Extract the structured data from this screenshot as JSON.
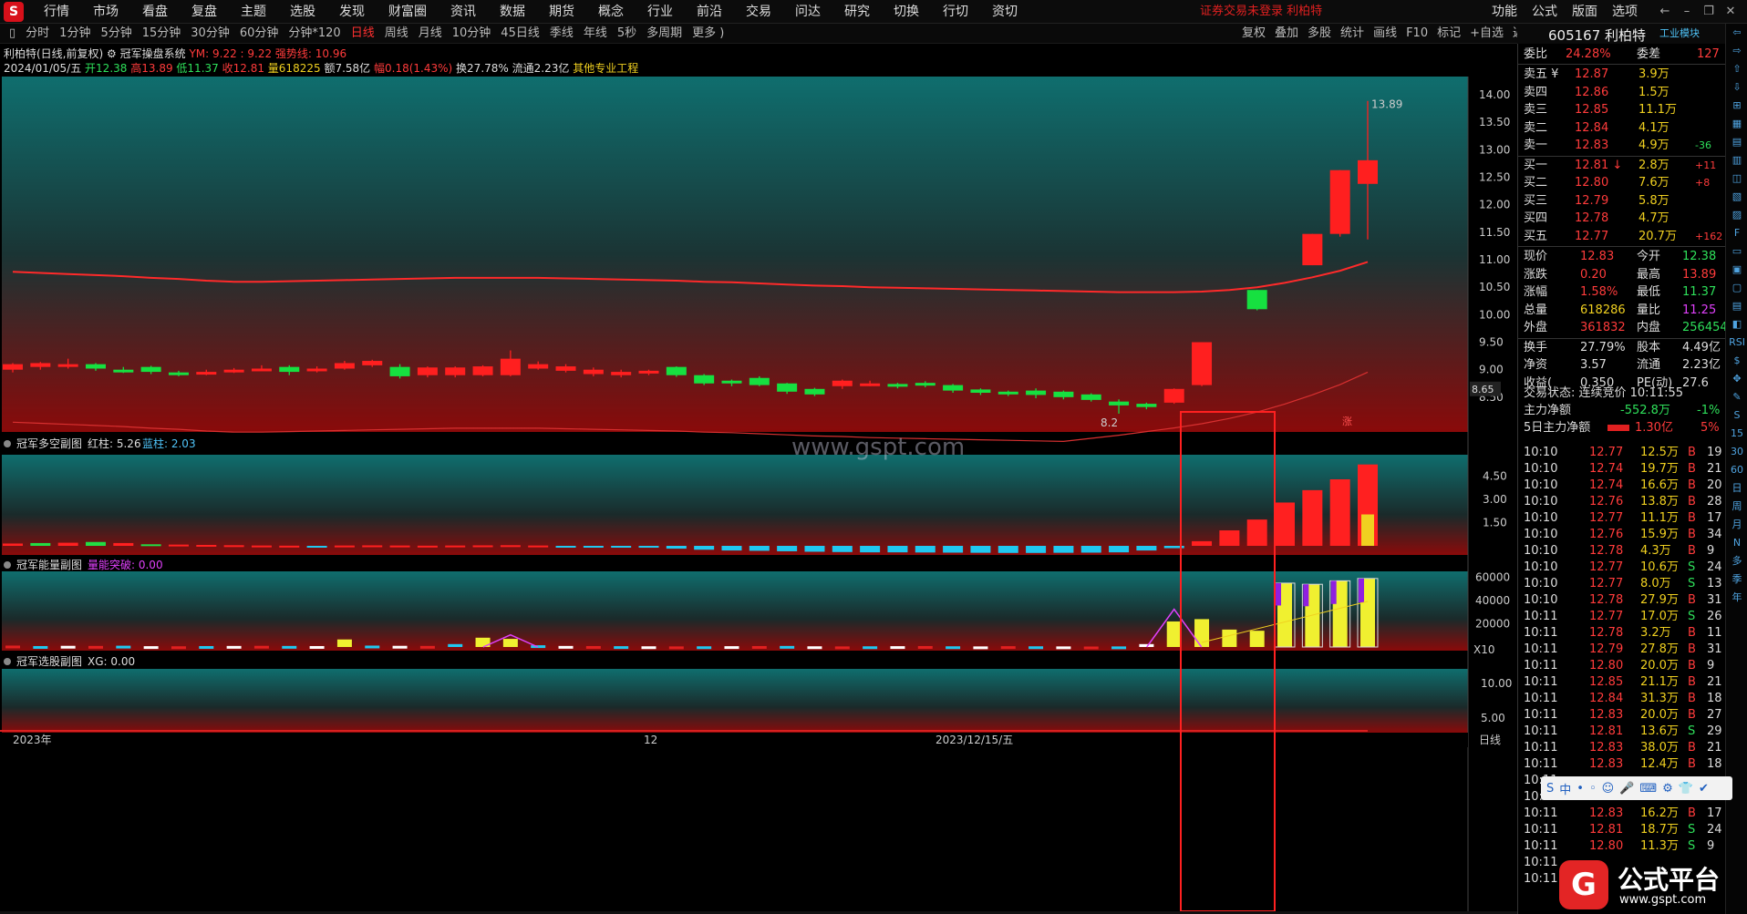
{
  "menubar": {
    "logo": "S",
    "items": [
      "行情",
      "市场",
      "看盘",
      "复盘",
      "主题",
      "选股",
      "发现",
      "财富圈",
      "资讯",
      "数据",
      "期货",
      "概念",
      "行业",
      "前沿",
      "交易",
      "问达",
      "研究",
      "切换",
      "行切",
      "资切"
    ],
    "status": "证券交易未登录 利柏特",
    "right_items": [
      "功能",
      "公式",
      "版面",
      "选项"
    ],
    "window_controls": [
      "←",
      "–",
      "❐",
      "✕"
    ]
  },
  "periodbar": {
    "items": [
      "分时",
      "1分钟",
      "5分钟",
      "15分钟",
      "30分钟",
      "60分钟",
      "分钟*120",
      "日线",
      "周线",
      "月线",
      "10分钟",
      "45日线",
      "季线",
      "年线",
      "5秒",
      "多周期",
      "更多 )"
    ],
    "active": "日线",
    "tools": [
      "复权",
      "叠加",
      "多股",
      "统计",
      "画线",
      "F10",
      "标记",
      "+自选",
      "返回"
    ]
  },
  "quote_head": {
    "code_name": "605167 利柏特",
    "sector": "工业模块"
  },
  "info": {
    "title": "利柏特(日线,前复权)",
    "system": "冠军操盘系统",
    "ym": "YM: 9.22 : 9.22 强势线: 10.96",
    "date": "2024/01/05/五",
    "open": "开12.38",
    "high": "高13.89",
    "low": "低11.37",
    "close": "收12.81",
    "volume": "量618225",
    "amount": "额7.58亿",
    "change": "幅0.18(1.43%)",
    "turnover": "换27.78%",
    "float": "流通2.23亿",
    "sector": "其他专业工程"
  },
  "panels": {
    "p1": {
      "title": "冠军多空副图",
      "red_label": "红柱: 5.26",
      "blue_label": "蓝柱: 2.03"
    },
    "p2": {
      "title": "冠军能量副图",
      "label": "量能突破: 0.00"
    },
    "p3": {
      "title": "冠军选股副图",
      "label": "XG: 0.00"
    }
  },
  "axes": {
    "main_ticks": [
      "14.00",
      "13.50",
      "13.00",
      "12.50",
      "12.00",
      "11.50",
      "11.00",
      "10.50",
      "10.00",
      "9.50",
      "9.00",
      "8.50"
    ],
    "current_price_tag": "8.65",
    "p1_ticks": [
      "4.50",
      "3.00",
      "1.50"
    ],
    "p2_ticks": [
      "60000",
      "40000",
      "20000"
    ],
    "p2_unit": "X10",
    "p3_ticks": [
      "10.00",
      "5.00"
    ],
    "date_labels": [
      "2023年",
      "12",
      "2023/12/15/五"
    ],
    "period_label": "日线",
    "peak_label": "13.89",
    "low_label": "8.2"
  },
  "watermark": "www.gspt.com",
  "order_book": {
    "weibi_label": "委比",
    "weibi_value": "24.28%",
    "weicha_label": "委差",
    "weicha_value": "127",
    "asks": [
      {
        "label": "卖五 ¥",
        "price": "12.87",
        "vol": "3.9万",
        "chg": ""
      },
      {
        "label": "卖四",
        "price": "12.86",
        "vol": "1.5万",
        "chg": ""
      },
      {
        "label": "卖三",
        "price": "12.85",
        "vol": "11.1万",
        "chg": ""
      },
      {
        "label": "卖二",
        "price": "12.84",
        "vol": "4.1万",
        "chg": ""
      },
      {
        "label": "卖一",
        "price": "12.83",
        "vol": "4.9万",
        "chg": "-36"
      }
    ],
    "bids": [
      {
        "label": "买一",
        "price": "12.81 ↓",
        "vol": "2.8万",
        "chg": "+11"
      },
      {
        "label": "买二",
        "price": "12.80",
        "vol": "7.6万",
        "chg": "+8"
      },
      {
        "label": "买三",
        "price": "12.79",
        "vol": "5.8万",
        "chg": ""
      },
      {
        "label": "买四",
        "price": "12.78",
        "vol": "4.7万",
        "chg": ""
      },
      {
        "label": "买五",
        "price": "12.77",
        "vol": "20.7万",
        "chg": "+162"
      }
    ]
  },
  "stats": [
    {
      "l1": "现价",
      "v1": "12.83",
      "l2": "今开",
      "v2": "12.38",
      "c1": "r",
      "c2": "g"
    },
    {
      "l1": "涨跌",
      "v1": "0.20",
      "l2": "最高",
      "v2": "13.89",
      "c1": "r",
      "c2": "r"
    },
    {
      "l1": "涨幅",
      "v1": "1.58%",
      "l2": "最低",
      "v2": "11.37",
      "c1": "r",
      "c2": "g"
    },
    {
      "l1": "总量",
      "v1": "618286",
      "l2": "量比",
      "v2": "11.25",
      "c1": "y",
      "c2": "m"
    },
    {
      "l1": "外盘",
      "v1": "361832",
      "l2": "内盘",
      "v2": "256454",
      "c1": "r",
      "c2": "g"
    },
    {
      "l1": "换手",
      "v1": "27.79%",
      "l2": "股本",
      "v2": "4.49亿",
      "c1": "w",
      "c2": "w"
    },
    {
      "l1": "净资",
      "v1": "3.57",
      "l2": "流通",
      "v2": "2.23亿",
      "c1": "w",
      "c2": "w"
    },
    {
      "l1": "收益(",
      "v1": "0.350",
      "l2": "PE(动)",
      "v2": "27.6",
      "c1": "w",
      "c2": "w"
    }
  ],
  "trade_status": "交易状态: 连续竞价 10:11:55",
  "main_net": {
    "label": "主力净额",
    "value": "-552.8万",
    "pct": "-1%"
  },
  "main_net5": {
    "label": "5日主力净额",
    "value": "1.30亿",
    "pct": "5%"
  },
  "ticks": [
    {
      "t": "10:10",
      "p": "12.77",
      "v": "12.5万",
      "s": "B",
      "n": "19"
    },
    {
      "t": "10:10",
      "p": "12.74",
      "v": "19.7万",
      "s": "B",
      "n": "21"
    },
    {
      "t": "10:10",
      "p": "12.74",
      "v": "16.6万",
      "s": "B",
      "n": "20"
    },
    {
      "t": "10:10",
      "p": "12.76",
      "v": "13.8万",
      "s": "B",
      "n": "28"
    },
    {
      "t": "10:10",
      "p": "12.77",
      "v": "11.1万",
      "s": "B",
      "n": "17"
    },
    {
      "t": "10:10",
      "p": "12.76",
      "v": "15.9万",
      "s": "B",
      "n": "34"
    },
    {
      "t": "10:10",
      "p": "12.78",
      "v": "4.3万",
      "s": "B",
      "n": "9"
    },
    {
      "t": "10:10",
      "p": "12.77",
      "v": "10.6万",
      "s": "S",
      "n": "24"
    },
    {
      "t": "10:10",
      "p": "12.77",
      "v": "8.0万",
      "s": "S",
      "n": "13"
    },
    {
      "t": "10:10",
      "p": "12.78",
      "v": "27.9万",
      "s": "B",
      "n": "31"
    },
    {
      "t": "10:11",
      "p": "12.77",
      "v": "17.0万",
      "s": "S",
      "n": "26"
    },
    {
      "t": "10:11",
      "p": "12.78",
      "v": "3.2万",
      "s": "B",
      "n": "11"
    },
    {
      "t": "10:11",
      "p": "12.79",
      "v": "27.8万",
      "s": "B",
      "n": "31"
    },
    {
      "t": "10:11",
      "p": "12.80",
      "v": "20.0万",
      "s": "B",
      "n": "9"
    },
    {
      "t": "10:11",
      "p": "12.85",
      "v": "21.1万",
      "s": "B",
      "n": "21"
    },
    {
      "t": "10:11",
      "p": "12.84",
      "v": "31.3万",
      "s": "B",
      "n": "18"
    },
    {
      "t": "10:11",
      "p": "12.83",
      "v": "20.0万",
      "s": "B",
      "n": "27"
    },
    {
      "t": "10:11",
      "p": "12.81",
      "v": "13.6万",
      "s": "S",
      "n": "29"
    },
    {
      "t": "10:11",
      "p": "12.83",
      "v": "38.0万",
      "s": "B",
      "n": "21"
    },
    {
      "t": "10:11",
      "p": "12.83",
      "v": "12.4万",
      "s": "B",
      "n": "18"
    },
    {
      "t": "10:11",
      "p": "",
      "v": "",
      "s": "",
      "n": ""
    },
    {
      "t": "10:11",
      "p": "",
      "v": "",
      "s": "",
      "n": ""
    },
    {
      "t": "10:11",
      "p": "12.83",
      "v": "16.2万",
      "s": "B",
      "n": "17"
    },
    {
      "t": "10:11",
      "p": "12.81",
      "v": "18.7万",
      "s": "S",
      "n": "24"
    },
    {
      "t": "10:11",
      "p": "12.80",
      "v": "11.3万",
      "s": "S",
      "n": "9"
    },
    {
      "t": "10:11",
      "p": "",
      "v": "",
      "s": "",
      "n": ""
    },
    {
      "t": "10:11",
      "p": "",
      "v": "",
      "s": "",
      "n": ""
    }
  ],
  "side_icons": [
    "⇦",
    "⇨",
    "⇧",
    "⇩",
    "⊞",
    "▦",
    "▤",
    "▥",
    "◫",
    "▧",
    "▨",
    "F",
    "▭",
    "▣",
    "▢",
    "▤",
    "◧",
    "RSI",
    "$",
    "✥",
    "✎",
    "S",
    "15",
    "30",
    "60",
    "日",
    "周",
    "月",
    "N",
    "多",
    "季",
    "年"
  ],
  "ime": {
    "items": [
      "S",
      "中",
      "•",
      "◦",
      "☺",
      "🎤",
      "⌨",
      "⚙",
      "👕",
      "✔"
    ]
  },
  "brand": {
    "logo": "G",
    "name": "公式平台",
    "url": "www.gspt.com"
  },
  "chart_data": {
    "type": "candlestick",
    "price_range": [
      8.0,
      14.2
    ],
    "candles": [
      [
        9.0,
        9.1,
        8.95,
        9.12
      ],
      [
        9.05,
        9.12,
        9.0,
        9.14
      ],
      [
        9.08,
        9.1,
        9.02,
        9.2
      ],
      [
        9.1,
        9.02,
        8.98,
        9.12
      ],
      [
        9.0,
        8.98,
        8.94,
        9.05
      ],
      [
        9.05,
        8.96,
        8.92,
        9.07
      ],
      [
        8.95,
        8.92,
        8.88,
        8.98
      ],
      [
        8.92,
        8.96,
        8.9,
        9.0
      ],
      [
        8.96,
        9.0,
        8.94,
        9.03
      ],
      [
        9.0,
        9.02,
        8.98,
        9.08
      ],
      [
        9.05,
        8.96,
        8.9,
        9.08
      ],
      [
        8.98,
        9.02,
        8.95,
        9.06
      ],
      [
        9.02,
        9.12,
        9.0,
        9.16
      ],
      [
        9.08,
        9.16,
        9.05,
        9.18
      ],
      [
        9.05,
        8.88,
        8.84,
        9.1
      ],
      [
        8.9,
        9.04,
        8.86,
        9.06
      ],
      [
        8.9,
        9.04,
        8.86,
        9.06
      ],
      [
        8.9,
        9.06,
        8.88,
        9.08
      ],
      [
        8.9,
        9.2,
        8.88,
        9.35
      ],
      [
        9.02,
        9.1,
        9.0,
        9.15
      ],
      [
        8.98,
        9.06,
        8.95,
        9.1
      ],
      [
        8.92,
        9.0,
        8.88,
        9.04
      ],
      [
        8.9,
        8.96,
        8.86,
        9.0
      ],
      [
        8.94,
        8.98,
        8.9,
        9.0
      ],
      [
        9.05,
        8.9,
        8.87,
        9.06
      ],
      [
        8.9,
        8.75,
        8.72,
        8.92
      ],
      [
        8.8,
        8.75,
        8.7,
        8.82
      ],
      [
        8.85,
        8.72,
        8.7,
        8.88
      ],
      [
        8.75,
        8.6,
        8.56,
        8.76
      ],
      [
        8.65,
        8.55,
        8.52,
        8.67
      ],
      [
        8.7,
        8.8,
        8.65,
        8.82
      ],
      [
        8.72,
        8.75,
        8.7,
        8.8
      ],
      [
        8.74,
        8.7,
        8.66,
        8.76
      ],
      [
        8.76,
        8.72,
        8.68,
        8.79
      ],
      [
        8.72,
        8.62,
        8.58,
        8.74
      ],
      [
        8.64,
        8.58,
        8.54,
        8.66
      ],
      [
        8.6,
        8.56,
        8.52,
        8.62
      ],
      [
        8.62,
        8.54,
        8.48,
        8.66
      ],
      [
        8.6,
        8.5,
        8.46,
        8.62
      ],
      [
        8.55,
        8.45,
        8.42,
        8.57
      ],
      [
        8.42,
        8.35,
        8.2,
        8.46
      ],
      [
        8.38,
        8.32,
        8.28,
        8.4
      ],
      [
        8.4,
        8.65,
        8.38,
        8.66
      ],
      [
        8.72,
        9.5,
        8.7,
        9.5
      ],
      [
        null,
        null,
        null,
        null
      ],
      [
        10.45,
        10.1,
        10.08,
        10.45
      ],
      [
        null,
        null,
        null,
        null
      ],
      [
        10.9,
        11.47,
        10.9,
        11.47
      ],
      [
        11.47,
        12.63,
        11.42,
        12.63
      ],
      [
        12.38,
        12.81,
        11.37,
        13.89
      ]
    ],
    "ma_line": [
      10.78,
      10.76,
      10.74,
      10.72,
      10.7,
      10.67,
      10.65,
      10.62,
      10.6,
      10.6,
      10.61,
      10.62,
      10.63,
      10.64,
      10.65,
      10.66,
      10.67,
      10.67,
      10.67,
      10.67,
      10.66,
      10.65,
      10.64,
      10.63,
      10.62,
      10.6,
      10.59,
      10.57,
      10.55,
      10.53,
      10.52,
      10.5,
      10.49,
      10.48,
      10.47,
      10.46,
      10.45,
      10.44,
      10.43,
      10.42,
      10.41,
      10.41,
      10.41,
      10.42,
      10.45,
      10.5,
      10.58,
      10.68,
      10.8,
      10.96
    ],
    "p1_values": [
      0.15,
      0.18,
      0.2,
      0.25,
      0.18,
      0.1,
      0.08,
      0.06,
      0.04,
      0.02,
      0.01,
      -0.01,
      0.02,
      0.03,
      0.02,
      0.01,
      0.02,
      0.03,
      0.04,
      0.02,
      -0.02,
      -0.05,
      -0.08,
      -0.12,
      -0.18,
      -0.25,
      -0.3,
      -0.32,
      -0.35,
      -0.38,
      -0.4,
      -0.42,
      -0.42,
      -0.43,
      -0.44,
      -0.45,
      -0.46,
      -0.46,
      -0.45,
      -0.44,
      -0.42,
      -0.3,
      -0.15,
      0.3,
      1.0,
      1.7,
      2.8,
      3.6,
      4.3,
      5.26
    ],
    "p2_values": [
      1200,
      800,
      1000,
      900,
      1100,
      700,
      600,
      800,
      900,
      1000,
      900,
      800,
      6500,
      1200,
      1000,
      900,
      2500,
      8000,
      7000,
      1500,
      900,
      800,
      700,
      600,
      500,
      600,
      700,
      800,
      900,
      600,
      500,
      600,
      700,
      800,
      600,
      500,
      700,
      600,
      500,
      400,
      500,
      2500,
      22000,
      24000,
      15000,
      14000,
      55000,
      54000,
      57000,
      59000
    ]
  }
}
